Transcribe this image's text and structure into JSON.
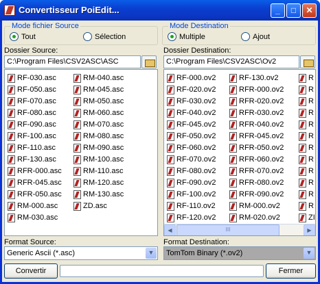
{
  "window": {
    "title": "Convertisseur PoiEdit..."
  },
  "source": {
    "group_label": "Mode fichier Source",
    "option_all": "Tout",
    "option_selection": "Sélection",
    "selected": "Tout",
    "folder_label": "Dossier Source:",
    "folder_path": "C:\\Program Files\\CSV2ASC\\ASC",
    "files": [
      "RF-030.asc",
      "RF-050.asc",
      "RF-070.asc",
      "RF-080.asc",
      "RF-090.asc",
      "RF-100.asc",
      "RF-110.asc",
      "RF-130.asc",
      "RFR-000.asc",
      "RFR-045.asc",
      "RFR-050.asc",
      "RM-000.asc",
      "RM-030.asc",
      "RM-040.asc",
      "RM-045.asc",
      "RM-050.asc",
      "RM-060.asc",
      "RM-070.asc",
      "RM-080.asc",
      "RM-090.asc",
      "RM-100.asc",
      "RM-110.asc",
      "RM-120.asc",
      "RM-130.asc",
      "ZD.asc"
    ],
    "format_label": "Format Source:",
    "format_value": "Generic Ascii (*.asc)"
  },
  "destination": {
    "group_label": "Mode Destination",
    "option_multiple": "Multiple",
    "option_add": "Ajout",
    "selected": "Multiple",
    "folder_label": "Dossier Destination:",
    "folder_path": "C:\\Program Files\\CSV2ASC\\Ov2",
    "files_col1": [
      "RF-000.ov2",
      "RF-020.ov2",
      "RF-030.ov2",
      "RF-040.ov2",
      "RF-045.ov2",
      "RF-050.ov2",
      "RF-060.ov2",
      "RF-070.ov2",
      "RF-080.ov2",
      "RF-090.ov2",
      "RF-100.ov2",
      "RF-110.ov2",
      "RF-120.ov2"
    ],
    "files_col2": [
      "RF-130.ov2",
      "RFR-000.ov2",
      "RFR-020.ov2",
      "RFR-030.ov2",
      "RFR-040.ov2",
      "RFR-045.ov2",
      "RFR-050.ov2",
      "RFR-060.ov2",
      "RFR-070.ov2",
      "RFR-080.ov2",
      "RFR-090.ov2",
      "RM-000.ov2",
      "RM-020.ov2"
    ],
    "files_col3": [
      "R",
      "R",
      "R",
      "R",
      "R",
      "R",
      "R",
      "R",
      "R",
      "R",
      "R",
      "R",
      "ZI"
    ],
    "scroll_thumb": "III",
    "format_label": "Format Destination:",
    "format_value": "TomTom Binary (*.ov2)"
  },
  "buttons": {
    "convert": "Convertir",
    "close": "Fermer"
  },
  "progress": {
    "value": 0
  },
  "icons": {
    "app": "app-icon",
    "minimize": "minimize-icon",
    "maximize": "maximize-icon",
    "close": "close-icon",
    "folder": "folder-icon",
    "file": "file-icon",
    "dropdown": "chevron-down-icon"
  },
  "colors": {
    "title_bar": "#0a3fd0",
    "window_bg": "#ece9d8",
    "group_label": "#0046d5",
    "radio_dot": "#21a121"
  }
}
